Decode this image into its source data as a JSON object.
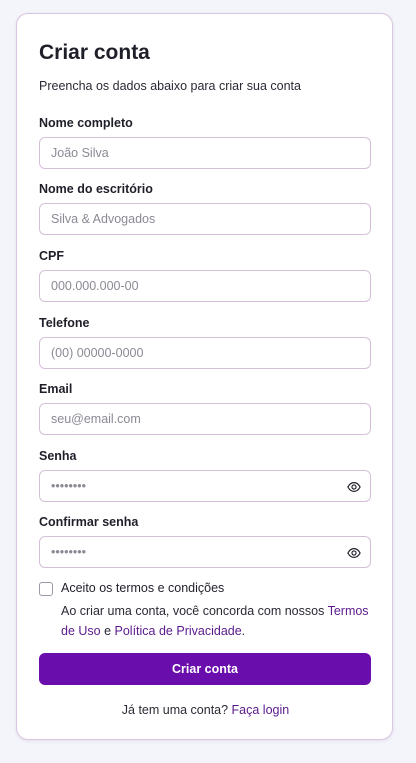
{
  "form": {
    "title": "Criar conta",
    "subtitle": "Preencha os dados abaixo para criar sua conta",
    "fields": [
      {
        "label": "Nome completo",
        "placeholder": "João Silva",
        "value": ""
      },
      {
        "label": "Nome do escritório",
        "placeholder": "Silva & Advogados",
        "value": ""
      },
      {
        "label": "CPF",
        "placeholder": "000.000.000-00",
        "value": ""
      },
      {
        "label": "Telefone",
        "placeholder": "(00) 00000-0000",
        "value": ""
      },
      {
        "label": "Email",
        "placeholder": "seu@email.com",
        "value": ""
      },
      {
        "label": "Senha",
        "placeholder": "••••••••",
        "value": ""
      },
      {
        "label": "Confirmar senha",
        "placeholder": "••••••••",
        "value": ""
      }
    ],
    "terms": {
      "checkbox_label": "Aceito os termos e condições",
      "text_before": "Ao criar uma conta, você concorda com nossos ",
      "terms_link": "Termos de Uso",
      "text_middle": " e ",
      "privacy_link": "Política de Privacidade",
      "text_after": "."
    },
    "submit_label": "Criar conta",
    "footer": {
      "text": "Já tem uma conta? ",
      "login_link": "Faça login"
    }
  },
  "icons": {
    "password_toggle": "eye-icon"
  },
  "colors": {
    "primary": "#6a0dad",
    "link": "#5a1a8c",
    "input_border": "#d5bfd8",
    "background": "#f4f4fb"
  }
}
